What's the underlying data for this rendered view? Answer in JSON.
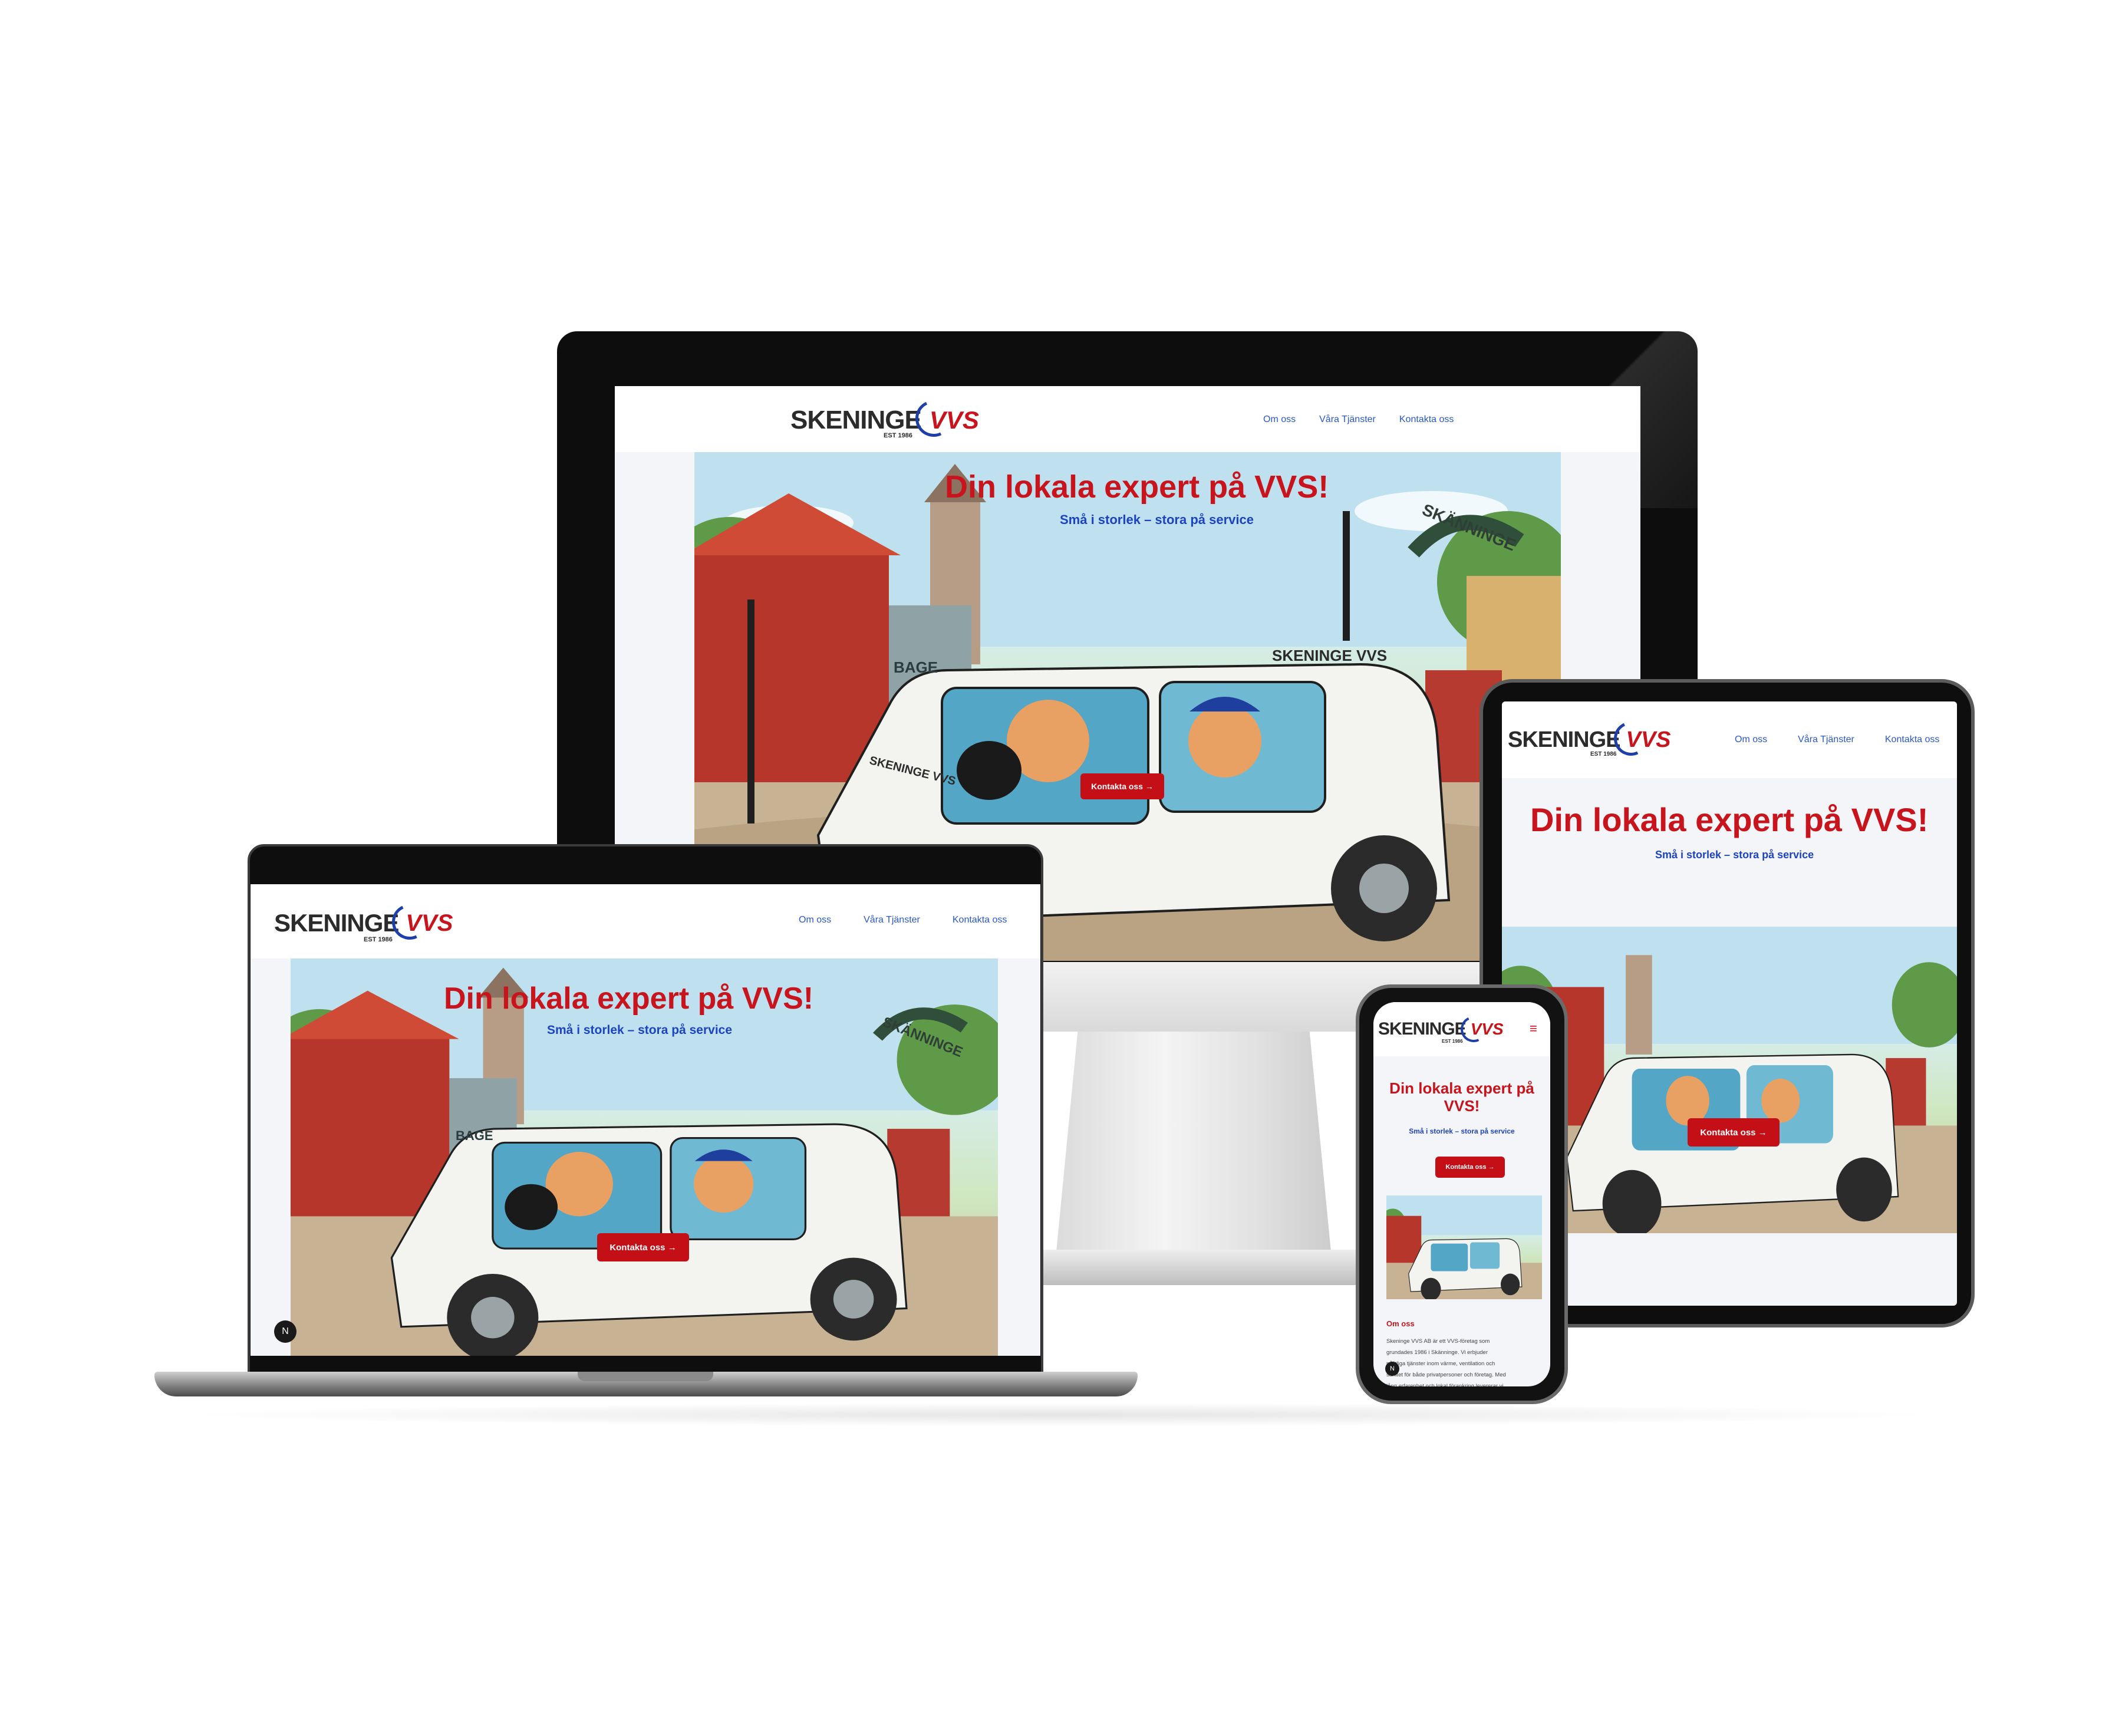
{
  "site": {
    "logo": {
      "word": "SKENINGE",
      "est": "EST 1986",
      "mark": "VVS"
    },
    "nav": [
      "Om oss",
      "Våra Tjänster",
      "Kontakta oss"
    ],
    "hero": {
      "title": "Din lokala expert på VVS!",
      "subtitle": "Små i storlek – stora på service",
      "cta": "Kontakta oss",
      "cta_arrow": "→"
    },
    "illustration": {
      "sign_text": "SKÄNNINGE",
      "shop_text": "BAGE",
      "van_logo": "SKENINGE VVS"
    },
    "menu_icon": "≡",
    "next_badge": "N",
    "about": {
      "title": "Om oss",
      "text_lines": [
        "Skeninge VVS AB är ett VVS-företag som",
        "grundades 1986 i Skänninge. Vi erbjuder",
        "pålitliga tjänster inom värme, ventilation och",
        "sanitet för både privatpersoner och företag. Med",
        "lång erfarenhet och lokal förankring levererar vi"
      ]
    }
  },
  "colors": {
    "brand_red": "#c8141c",
    "brand_blue": "#1d44c0",
    "nav_blue": "#2a58c9",
    "page_bg": "#f3f5f8"
  },
  "devices": [
    "desktop-monitor",
    "tablet",
    "laptop",
    "smartphone"
  ]
}
